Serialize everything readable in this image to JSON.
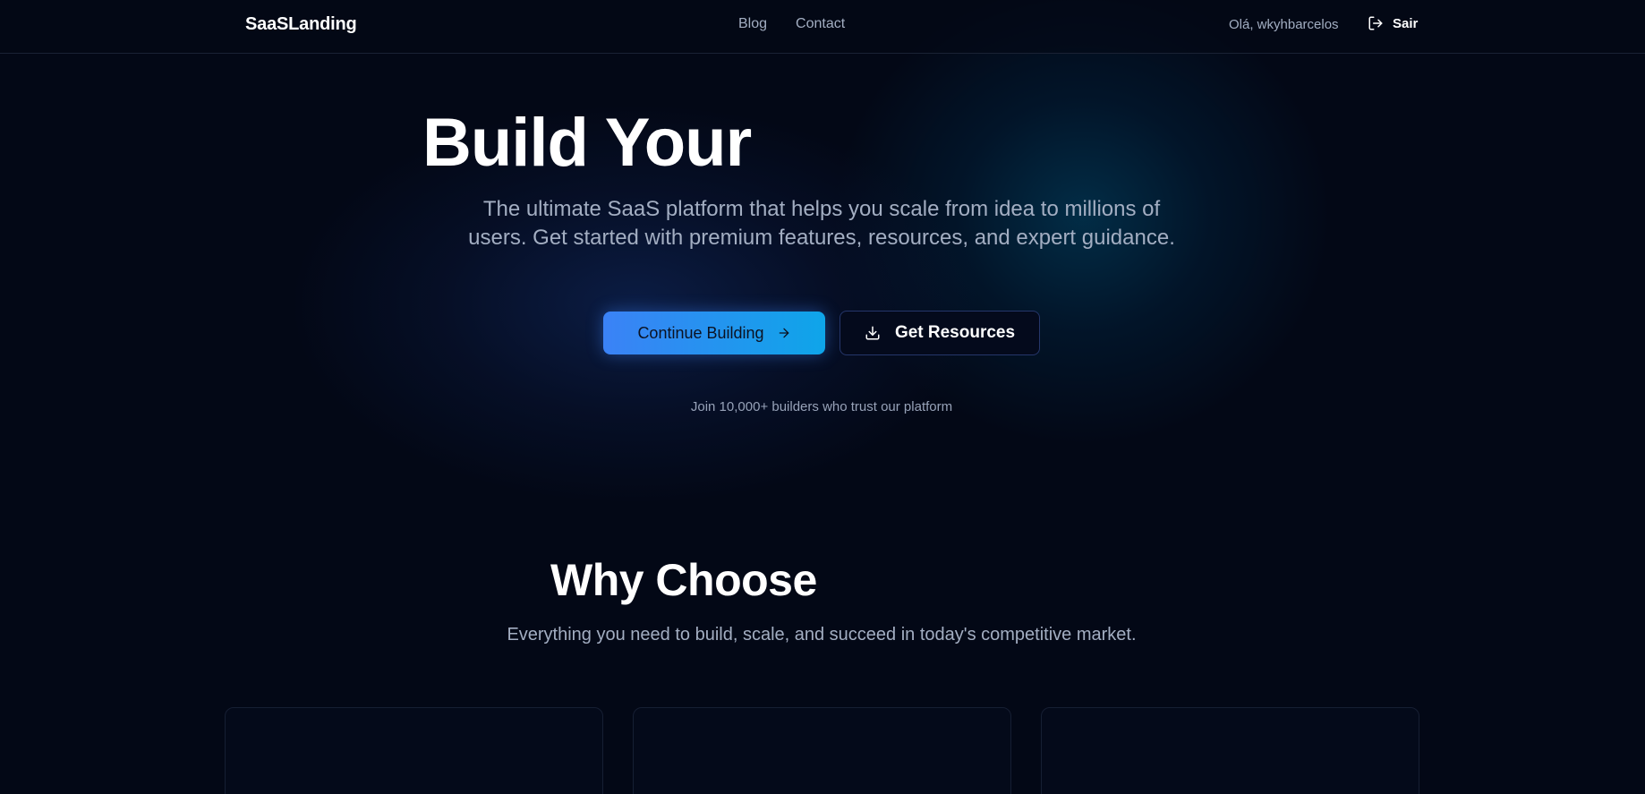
{
  "header": {
    "logo": "SaaSLanding",
    "nav": [
      {
        "label": "Blog"
      },
      {
        "label": "Contact"
      }
    ],
    "greeting": "Olá, wkyhbarcelos",
    "logout_label": "Sair",
    "logout_icon": "logout-icon"
  },
  "hero": {
    "title": "Build Your",
    "subtitle": "The ultimate SaaS platform that helps you scale from idea to millions of users. Get started with premium features, resources, and expert guidance.",
    "primary_button": {
      "label": "Continue Building",
      "icon": "arrow-right-icon"
    },
    "secondary_button": {
      "label": "Get Resources",
      "icon": "download-icon"
    },
    "trust_text": "Join 10,000+ builders who trust our platform"
  },
  "features": {
    "title": "Why Choose",
    "subtitle": "Everything you need to build, scale, and succeed in today's competitive market.",
    "cards": [
      {},
      {},
      {}
    ]
  },
  "colors": {
    "background": "#030816",
    "accent_start": "#3b82f6",
    "accent_end": "#0ea5e9",
    "muted_text": "#a3aec2"
  }
}
